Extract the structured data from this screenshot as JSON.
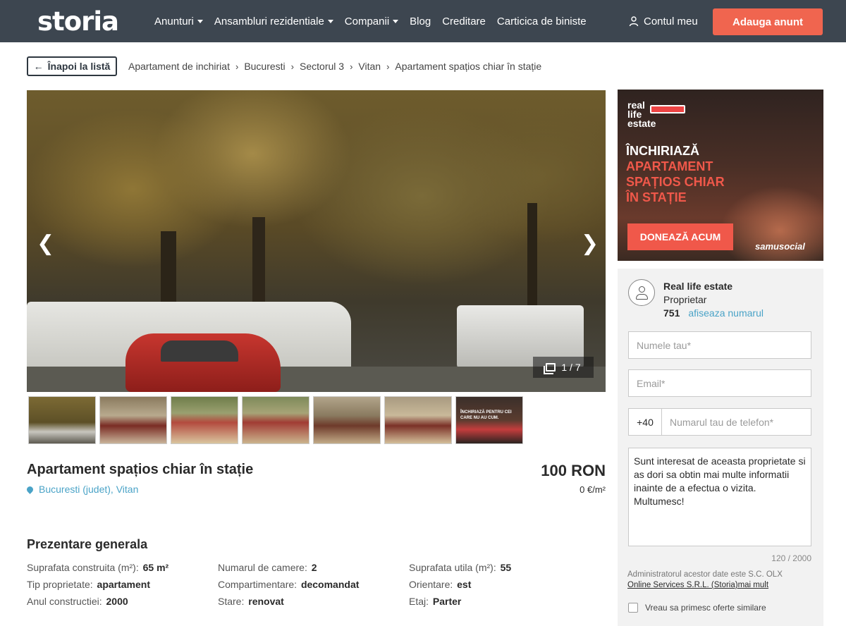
{
  "header": {
    "logo": "storia",
    "nav": [
      {
        "label": "Anunturi",
        "dropdown": true
      },
      {
        "label": "Ansambluri rezidentiale",
        "dropdown": true
      },
      {
        "label": "Companii",
        "dropdown": true
      },
      {
        "label": "Blog",
        "dropdown": false
      },
      {
        "label": "Creditare",
        "dropdown": false
      },
      {
        "label": "Carticica de biniste",
        "dropdown": false
      }
    ],
    "account_label": "Contul meu",
    "cta_label": "Adauga anunt",
    "colors": {
      "bar": "#3d4650",
      "accent": "#f0654f"
    }
  },
  "breadcrumb": {
    "back_label": "Înapoi la listă",
    "items": [
      "Apartament de inchiriat",
      "Bucuresti",
      "Sectorul 3",
      "Vitan",
      "Apartament spațios chiar în stație"
    ]
  },
  "gallery": {
    "counter": "1 / 7",
    "prev_icon": "chevron-left-icon",
    "next_icon": "chevron-right-icon",
    "thumb_7_text": "ÎNCHIRIAZĂ PENTRU CEI CARE NU AU CUM."
  },
  "listing": {
    "title": "Apartament spațios chiar în stație",
    "location": "Bucuresti (judet), Vitan",
    "price": "100 RON",
    "price_per_sqm": "0 €/m²"
  },
  "overview": {
    "title": "Prezentare generala",
    "specs": [
      {
        "label": "Suprafata construita (m²):",
        "value": "65 m²"
      },
      {
        "label": "Numarul de camere:",
        "value": "2"
      },
      {
        "label": "Suprafata utila (m²):",
        "value": "55"
      },
      {
        "label": "Tip proprietate:",
        "value": "apartament"
      },
      {
        "label": "Compartimentare:",
        "value": "decomandat"
      },
      {
        "label": "Orientare:",
        "value": "est"
      },
      {
        "label": "Anul constructiei:",
        "value": "2000"
      },
      {
        "label": "Stare:",
        "value": "renovat"
      },
      {
        "label": "Etaj:",
        "value": "Parter"
      }
    ]
  },
  "ad": {
    "logo_line1": "real",
    "logo_line2": "life",
    "logo_line3": "estate",
    "headline_white": "ÎNCHIRIAZĂ",
    "headline_red_1": "APARTAMENT",
    "headline_red_2": "SPAȚIOS CHIAR",
    "headline_red_3": "ÎN STAȚIE",
    "button_label": "DONEAZĂ ACUM",
    "brand": "samusocial"
  },
  "contact": {
    "name": "Real life estate",
    "role": "Proprietar",
    "phone_prefix": "751",
    "show_number_label": "afiseaza numarul",
    "name_placeholder": "Numele tau*",
    "email_placeholder": "Email*",
    "phone_code": "+40",
    "phone_placeholder": "Numarul tau de telefon*",
    "message": "Sunt interesat de aceasta proprietate si as dori sa obtin mai multe informatii inainte de a efectua o vizita. Multumesc!",
    "char_count": "120 / 2000",
    "admin_note": "Administratorul acestor date este S.C. OLX",
    "admin_link": "Online Services S.R.L. (Storia)mai mult",
    "optin_label": "Vreau sa primesc oferte similare"
  }
}
